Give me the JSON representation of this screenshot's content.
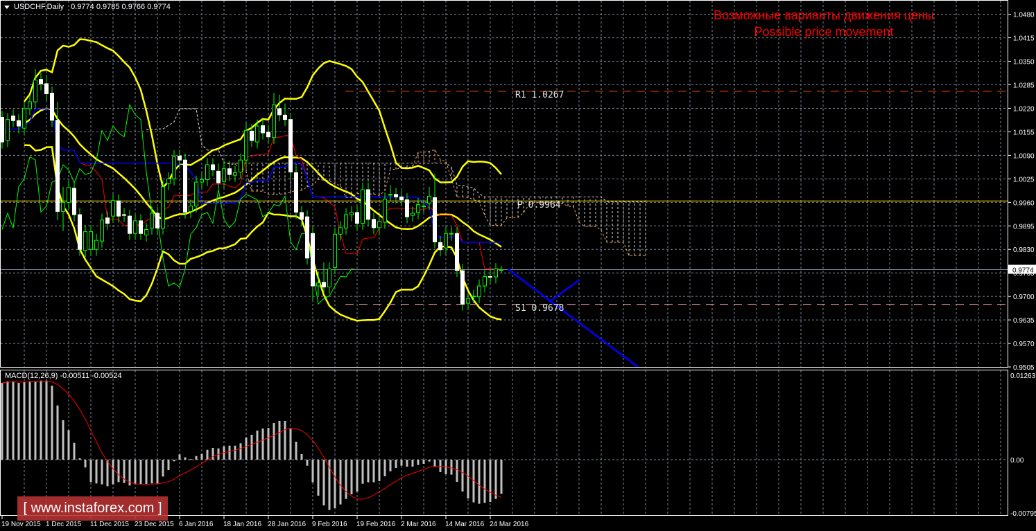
{
  "header": {
    "symbol": "USDCHF,Daily",
    "ohlc": "0.9774 0.9785 0.9766 0.9774"
  },
  "annotation": {
    "line1": "Возможные варианты движения цены",
    "line2": "Possible price movement",
    "color": "#ff0000"
  },
  "pivots": [
    {
      "text": "R1 1.0267",
      "value": 1.0267,
      "color": "#ff4500"
    },
    {
      "text": "P 0.9964",
      "value": 0.9964,
      "color": "#ffd700"
    },
    {
      "text": "S1 0.9678",
      "value": 0.9678,
      "color": "#e8a09a"
    }
  ],
  "price_axis": {
    "ticks": [
      "1.0480",
      "1.0415",
      "1.0350",
      "1.0285",
      "1.0220",
      "1.0155",
      "1.0090",
      "1.0025",
      "0.9960",
      "0.9895",
      "0.9830",
      "0.9765",
      "0.9700",
      "0.9635",
      "0.9570",
      "0.9505"
    ],
    "current": "0.9774"
  },
  "macd": {
    "title": "MACD(12,26,9) -0.00511 -0.00524",
    "axis": [
      "0.01263",
      "0.00",
      "-0.00795"
    ],
    "hist": [
      0.01149,
      0.01173,
      0.01173,
      0.01149,
      0.01163,
      0.01173,
      0.01173,
      0.01183,
      0.01183,
      0.01107,
      0.00811,
      0.0059,
      0.00442,
      0.00252,
      0.00021,
      -0.00117,
      -0.00335,
      -0.00355,
      -0.00369,
      -0.00397,
      -0.00369,
      -0.00335,
      -0.00348,
      -0.00386,
      -0.00369,
      -0.00369,
      -0.00362,
      -0.00355,
      -0.00355,
      -0.00252,
      -0.00155,
      -0.00024,
      0.00079,
      0.00035,
      0.0001,
      0.00055,
      0.00086,
      0.00148,
      0.00176,
      0.00169,
      0.002,
      0.0021,
      0.0021,
      0.00245,
      0.00331,
      0.00373,
      0.00435,
      0.00466,
      0.00476,
      0.00549,
      0.0058,
      0.0058,
      0.00462,
      0.00269,
      0.00083,
      -0.0009,
      -0.00338,
      -0.00538,
      -0.00683,
      -0.00752,
      -0.00725,
      -0.00669,
      -0.00587,
      -0.00518,
      -0.00476,
      -0.00359,
      -0.00338,
      -0.00338,
      -0.00321,
      -0.00248,
      -0.00173,
      -0.00124,
      -0.0009,
      -0.00104,
      -0.00104,
      -0.00079,
      -0.00062,
      -0.00028,
      -0.0011,
      -0.00186,
      -0.00217,
      -0.00224,
      -0.00331,
      -0.00476,
      -0.0058,
      -0.00638,
      -0.00659,
      -0.00645,
      -0.00631,
      -0.00587,
      -0.00511
    ]
  },
  "date_labels": [
    {
      "text": "19 Nov 2015",
      "bar": 0
    },
    {
      "text": "1 Dec 2015",
      "bar": 8
    },
    {
      "text": "11 Dec 2015",
      "bar": 16
    },
    {
      "text": "23 Dec 2015",
      "bar": 24
    },
    {
      "text": "6 Jan 2016",
      "bar": 32
    },
    {
      "text": "18 Jan 2016",
      "bar": 40
    },
    {
      "text": "28 Jan 2016",
      "bar": 48
    },
    {
      "text": "9 Feb 2016",
      "bar": 56
    },
    {
      "text": "19 Feb 2016",
      "bar": 64
    },
    {
      "text": "2 Mar 2016",
      "bar": 72
    },
    {
      "text": "14 Mar 2016",
      "bar": 80
    },
    {
      "text": "24 Mar 2016",
      "bar": 88
    }
  ],
  "watermark": "[ www.instaforex.com ]",
  "chart_data": {
    "type": "candlestick",
    "title": "USDCHF,Daily",
    "ylim": [
      0.9505,
      1.048
    ],
    "indicators": [
      "Bollinger Bands",
      "Ichimoku",
      "MACD(12,26,9)"
    ],
    "ohlc": [
      [
        1.0195,
        1.0213,
        1.0109,
        1.0127
      ],
      [
        1.0131,
        1.0207,
        1.0113,
        1.0189
      ],
      [
        1.0199,
        1.0217,
        1.0168,
        1.0186
      ],
      [
        1.0186,
        1.0204,
        1.0151,
        1.0171
      ],
      [
        1.0165,
        1.0237,
        1.0147,
        1.0219
      ],
      [
        1.0219,
        1.0256,
        1.0201,
        1.0238
      ],
      [
        1.0238,
        1.0328,
        1.022,
        1.0298
      ],
      [
        1.03,
        1.0318,
        1.027,
        1.0288
      ],
      [
        1.0288,
        1.0313,
        1.0242,
        1.026
      ],
      [
        1.0262,
        1.028,
        1.0169,
        1.0187
      ],
      [
        1.0187,
        1.0238,
        0.9911,
        0.9935
      ],
      [
        0.9935,
        1.0003,
        0.9881,
        0.996
      ],
      [
        0.996,
        1.0019,
        0.9942,
        1.0001
      ],
      [
        0.9999,
        1.0017,
        0.9908,
        0.9926
      ],
      [
        0.9926,
        0.9944,
        0.9812,
        0.983
      ],
      [
        0.9827,
        0.9897,
        0.9809,
        0.9879
      ],
      [
        0.983,
        0.9897,
        0.9812,
        0.9879
      ],
      [
        0.983,
        0.9873,
        0.9812,
        0.9855
      ],
      [
        0.9853,
        0.9929,
        0.9835,
        0.9911
      ],
      [
        0.9917,
        0.9935,
        0.9884,
        0.9902
      ],
      [
        0.9922,
        0.9983,
        0.9904,
        0.9965
      ],
      [
        0.9964,
        0.9982,
        0.9904,
        0.9922
      ],
      [
        0.9926,
        0.9944,
        0.9906,
        0.9924
      ],
      [
        0.9922,
        0.994,
        0.9856,
        0.9874
      ],
      [
        0.9874,
        0.9927,
        0.9856,
        0.9909
      ],
      [
        0.9909,
        0.9927,
        0.9856,
        0.9874
      ],
      [
        0.987,
        0.9903,
        0.9852,
        0.9885
      ],
      [
        0.9889,
        0.9948,
        0.9871,
        0.993
      ],
      [
        0.993,
        0.9948,
        0.9871,
        0.9889
      ],
      [
        0.9889,
        1.0021,
        0.9871,
        1.0003
      ],
      [
        1.0012,
        1.0043,
        0.9994,
        1.0025
      ],
      [
        1.0025,
        1.0104,
        1.0007,
        1.0086
      ],
      [
        1.0088,
        1.0106,
        1.0059,
        1.0077
      ],
      [
        1.0077,
        1.0095,
        0.9915,
        0.9933
      ],
      [
        0.9935,
        0.9968,
        0.9917,
        0.995
      ],
      [
        0.995,
        1.0034,
        0.9932,
        1.0016
      ],
      [
        1.0016,
        1.0041,
        0.9998,
        1.0023
      ],
      [
        1.0023,
        1.0082,
        1.0005,
        1.0064
      ],
      [
        1.0064,
        1.0082,
        1.0032,
        1.005
      ],
      [
        1.0046,
        1.0067,
        0.9996,
        1.0014
      ],
      [
        1.0018,
        1.0074,
        1.0,
        1.0053
      ],
      [
        1.0053,
        1.0074,
        1.0019,
        1.0037
      ],
      [
        1.0035,
        1.006,
        1.0017,
        1.0042
      ],
      [
        1.0044,
        1.0095,
        1.0026,
        1.0077
      ],
      [
        1.0077,
        1.0179,
        1.0059,
        1.0159
      ],
      [
        1.0157,
        1.0177,
        1.0113,
        1.0131
      ],
      [
        1.0127,
        1.0189,
        1.0109,
        1.0171
      ],
      [
        1.0172,
        1.019,
        1.0134,
        1.0152
      ],
      [
        1.0154,
        1.0174,
        1.0123,
        1.0141
      ],
      [
        1.0139,
        1.0263,
        1.0121,
        1.023
      ],
      [
        1.0219,
        1.0258,
        1.0184,
        1.0202
      ],
      [
        1.0201,
        1.0233,
        1.0171,
        1.0189
      ],
      [
        1.0189,
        1.0207,
        1.0026,
        1.0044
      ],
      [
        1.0042,
        1.006,
        0.9915,
        0.9933
      ],
      [
        0.9932,
        0.995,
        0.9895,
        0.9913
      ],
      [
        0.992,
        0.9938,
        0.9788,
        0.9806
      ],
      [
        0.9874,
        0.9892,
        0.9687,
        0.9729
      ],
      [
        0.9729,
        0.9769,
        0.9702,
        0.9737
      ],
      [
        0.9739,
        0.9794,
        0.9708,
        0.9726
      ],
      [
        0.9726,
        0.9794,
        0.9708,
        0.9776
      ],
      [
        0.978,
        0.989,
        0.9762,
        0.9872
      ],
      [
        0.9872,
        0.9908,
        0.9854,
        0.989
      ],
      [
        0.9889,
        0.9944,
        0.9871,
        0.9926
      ],
      [
        0.9926,
        0.995,
        0.9908,
        0.9932
      ],
      [
        0.9932,
        0.995,
        0.9884,
        0.9902
      ],
      [
        0.9902,
        1.0015,
        0.9884,
        0.9995
      ],
      [
        0.9995,
        1.0015,
        0.9895,
        0.9913
      ],
      [
        0.9913,
        0.9931,
        0.9872,
        0.989
      ],
      [
        0.989,
        0.9925,
        0.9872,
        0.9907
      ],
      [
        0.9905,
        0.9987,
        0.9887,
        0.9969
      ],
      [
        0.998,
        1.0008,
        0.9962,
        0.9982
      ],
      [
        0.9982,
        1.0,
        0.9957,
        0.9975
      ],
      [
        0.9975,
        0.9993,
        0.9949,
        0.9967
      ],
      [
        0.9967,
        0.9985,
        0.9902,
        0.992
      ],
      [
        0.9924,
        0.9948,
        0.9906,
        0.993
      ],
      [
        0.9932,
        0.9972,
        0.9914,
        0.9954
      ],
      [
        0.9948,
        0.9968,
        0.993,
        0.995
      ],
      [
        0.9958,
        1.0003,
        0.994,
        0.9977
      ],
      [
        0.9973,
        1.0038,
        0.9833,
        0.9851
      ],
      [
        0.9849,
        0.9867,
        0.9811,
        0.9829
      ],
      [
        0.9834,
        0.9892,
        0.9816,
        0.9874
      ],
      [
        0.9872,
        0.9892,
        0.9854,
        0.9874
      ],
      [
        0.9874,
        0.9892,
        0.9754,
        0.9772
      ],
      [
        0.9771,
        0.9789,
        0.9661,
        0.9679
      ],
      [
        0.9681,
        0.9712,
        0.9663,
        0.9694
      ],
      [
        0.9699,
        0.9719,
        0.9681,
        0.9701
      ],
      [
        0.9699,
        0.9747,
        0.9681,
        0.9729
      ],
      [
        0.9729,
        0.9773,
        0.9711,
        0.9755
      ],
      [
        0.9755,
        0.9773,
        0.9736,
        0.9754
      ],
      [
        0.9754,
        0.9792,
        0.9736,
        0.9776
      ],
      [
        0.9774,
        0.9785,
        0.9766,
        0.9774
      ]
    ]
  }
}
